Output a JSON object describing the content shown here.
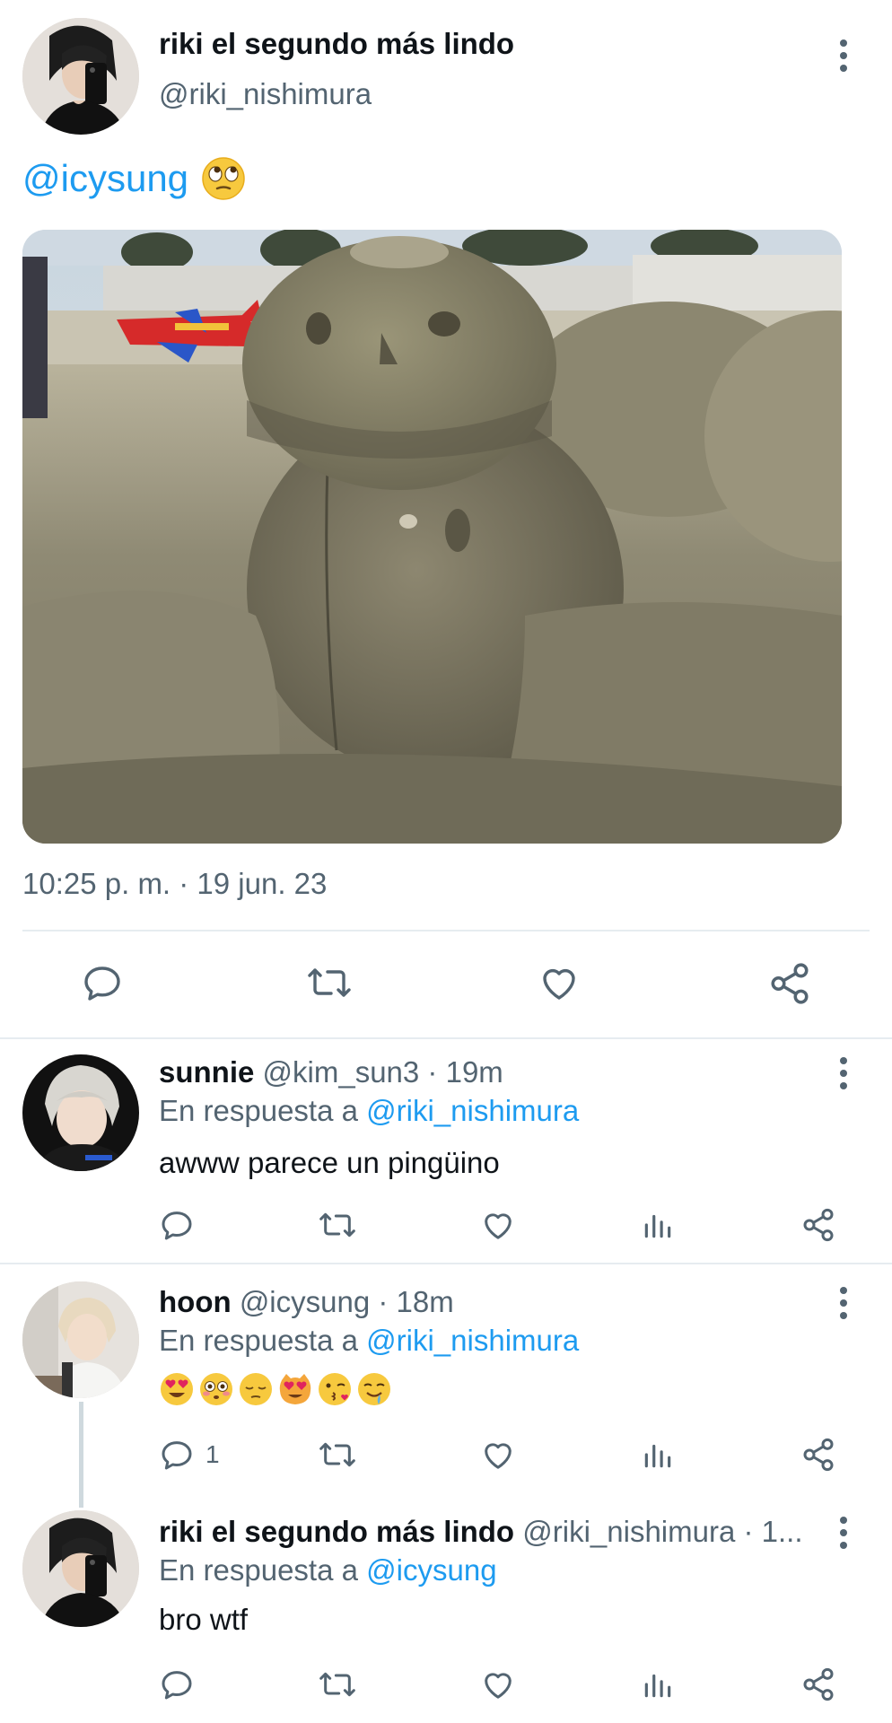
{
  "main_tweet": {
    "author_name": "riki el segundo más lindo",
    "author_handle": "@riki_nishimura",
    "text_mention": "@icysung",
    "text_emoji": "face-with-rolling-eyes-emoji",
    "timestamp": "10:25 p. m. · 19 jun. 23",
    "actions": [
      "reply-icon",
      "retweet-icon",
      "like-icon",
      "share-icon"
    ]
  },
  "replies": [
    {
      "name": "sunnie",
      "handle_time": "@kim_sun3 · 19m",
      "reply_prefix": "En respuesta a",
      "reply_to": "@riki_nishimura",
      "body": "awww parece un pingüino",
      "reply_count": ""
    },
    {
      "name": "hoon",
      "handle_time": "@icysung · 18m",
      "reply_prefix": "En respuesta a",
      "reply_to": "@riki_nishimura",
      "emojis": [
        "heart-eyes-emoji",
        "flushed-face-emoji",
        "pensive-face-emoji",
        "heart-eyes-cat-emoji",
        "face-blowing-kiss-emoji",
        "drooling-face-emoji"
      ],
      "reply_count": "1"
    },
    {
      "name": "riki el segundo más lindo",
      "handle_time": "@riki_nishimura · 1...",
      "reply_prefix": "En respuesta a",
      "reply_to": "@icysung",
      "body": "bro wtf",
      "reply_count": ""
    }
  ],
  "colors": {
    "link": "#1d9bf0",
    "secondary_text": "#536471",
    "divider": "#e6ecf0",
    "thread_line": "#cfd9de"
  }
}
